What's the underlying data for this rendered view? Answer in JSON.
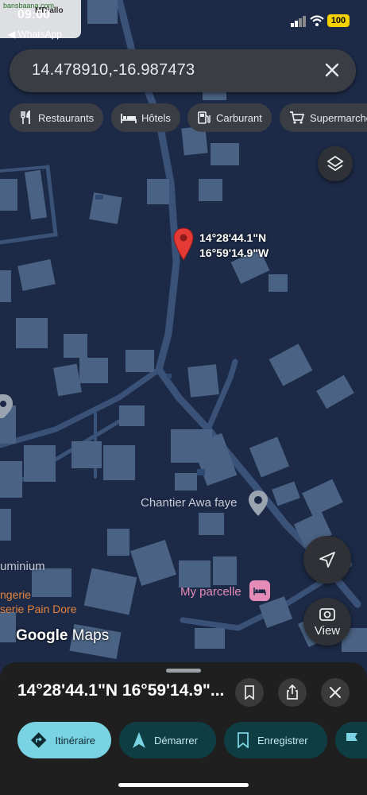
{
  "status_bar": {
    "time": "09:00",
    "back_app": "◀ WhatsApp",
    "watermark": "bansbaana.com",
    "watermark_sub": "MDiallo",
    "battery": "100"
  },
  "search": {
    "query": "14.478910,-16.987473",
    "clear_icon": "close-icon"
  },
  "chips": [
    {
      "label": "Restaurants",
      "icon": "fork-knife-icon"
    },
    {
      "label": "Hôtels",
      "icon": "bed-icon"
    },
    {
      "label": "Carburant",
      "icon": "fuel-icon"
    },
    {
      "label": "Supermarché",
      "icon": "cart-icon"
    }
  ],
  "map": {
    "pin_lat": "14°28'44.1\"N",
    "pin_lng": "16°59'14.9\"W",
    "places": {
      "chantier": "Chantier Awa faye",
      "aluminium": "uminium",
      "boulangerie1": "ngerie",
      "boulangerie2": "serie Pain Dore",
      "parcelle": "My parcelle"
    },
    "logo_google": "Google",
    "logo_maps": "Maps",
    "view_label": "View",
    "colors": {
      "background": "#1c2a47",
      "building": "#4a6283",
      "road": "#3a5279",
      "pin": "#e53935"
    }
  },
  "sheet": {
    "title": "14°28'44.1\"N 16°59'14.9\"...",
    "actions": {
      "itineraire": "Itinéraire",
      "demarrer": "Démarrer",
      "enregistrer": "Enregistrer"
    },
    "colors": {
      "primary": "#7ad3e3",
      "secondary": "#0f3d44"
    }
  }
}
